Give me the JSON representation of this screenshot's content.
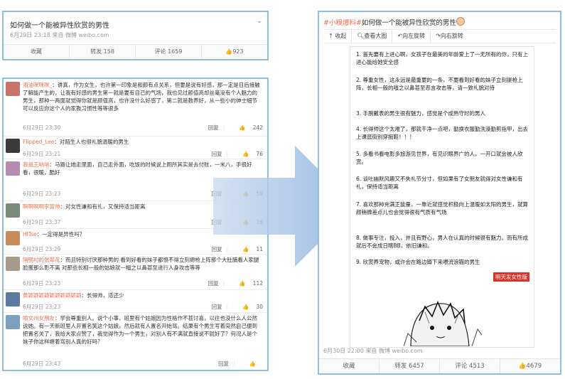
{
  "card1": {
    "title": "如何做一个能被异性欣赏的男性",
    "meta": "6月29日 23:18 来自 微博 weibo.com",
    "actions": [
      "收藏",
      "转发 158",
      "评论 1659",
      "923"
    ]
  },
  "comments": [
    {
      "user": "湘油咪咪咪_",
      "text": "：讲真，作为女生，也许第一印象是和颜有点关系，但要是说有好感，那一定是日后接触了解能产生的，让我有好感的男生第一就是要有自己的气场，我也见过颜值高却丝毫没有个人魅力的男生，那种一两面就觉得你就是颜值高，也许没什么好感了，第二就是教养好，从一些小的绅士细节可以反应你这个人的家教习惯性等等很多",
      "time": "6月29日 23:30",
      "reply": "回复",
      "likes": "242",
      "color": "#c9746a"
    },
    {
      "user": "Flipped_Lee",
      "text": "：对陌生人也很礼貌温暖的男生",
      "time": "6月29日 23:21",
      "reply": "回复",
      "likes": "76",
      "color": "#3a3a3a"
    },
    {
      "user": "我是王呐呐",
      "text": "：马路让她走里面，自己走外面，吃饭的时候说上厕所其实是去付账，一米八，手很好看，很暖，酷好",
      "time": "6月29日 23:23",
      "reply": "回复",
      "likes": "59",
      "color": "#b58bb0"
    },
    {
      "user": "啊啊啊啊李富帅",
      "text": "：对女性谦和有礼，又保持适当距离",
      "time": "6月29日 23:37",
      "reply": "回复",
      "likes": "16",
      "color": "#7a8a7a"
    },
    {
      "user": "HITse",
      "text": "：一定得是异性吗？",
      "time": "6月29日 23:29",
      "reply": "回复",
      "likes": "11",
      "color": "#c78a5a"
    },
    {
      "user": "隔壁村的张翠花",
      "text": "：而且特别讨厌那种男的 看到好看的妹子都恨不得立刻摁枪上阵那个大肚腩看人家腿脸蛋那么影不离 对那些长相一般的姑娘就一幅之以鼻甚至进行人身攻击等等",
      "time": "6月29日 23:23",
      "reply": "回复",
      "likes": "112",
      "color": "#a89a8a"
    },
    {
      "user": "黄颖颖颖颖颖颖颖颖颖颖",
      "text": "：长得帅，适还少",
      "time": "6月29日 23:23",
      "reply": "回复",
      "likes": "30",
      "color": "#5a7aa0"
    },
    {
      "user": "喻文州女朋友",
      "text": "：学会尊重别人。说个小事，班里有个姑娘因为性格作不甚讨喜，以往也没什么人公然说她。有一天新班里人开置名笑这个姑娘，然后就有人置名开始骂。结果有个男生写着突然自己便到把置名关了，我给大家点赞了，我觉得作为一个男生，对别人有不满就直接说不就好了？何况人是个妹子你这样缠着骂别人真的好吗？",
      "time": "6月29日 23:43",
      "reply": "回复",
      "likes": "",
      "color": "#7aa0c0"
    }
  ],
  "post": {
    "tag": "#小糗爆料#",
    "title": "如何做一个能被异性欣赏的男性",
    "toolbar": [
      "收起",
      "查看大图",
      "向左旋转",
      "向右旋转"
    ],
    "items": [
      "1. 首先要有上进心啊，女孩子在最美的年龄爱上了一无所有的你，只有上进心能给她安全感",
      "2. 尊重女性，这永远是最重要的一条，不要看到好看的妹子立刻提枪上阵，长相一般的嗤之以鼻甚至恶言攻击等，请一致礼貌对待",
      "3. 手腕戴表的男生很有魅力，感觉是个成熟守时的男人",
      "4. 长得帅这个太难了，那就干净一点吧，勤换衣服勤洗澡勤剪指甲，出去上课逛街别穿拖鞋！！！",
      "5. 多看书看电影多旅游见世界，有见识眼界广的人，一开口就会被人欣赏。",
      "6. 谈吐幽默风趣又不失礼节分寸，但如果有了女朋友就得对女性谦和有礼，保持适当距离",
      "7. 喜欢那种充满正能量，一靠近就感觉积极向上温暖如太阳的男生，就算颜稍微差点儿也会觉得很有气质有气场",
      "8. 做事专注，投入，并且有野心，男人在认真的时候很有魅力。而有所成就后不会成日瞎BB，依旧谦和。",
      "9. 欣赏养宠物，或许会在路边蹲下来喂流浪猫的男生"
    ],
    "brand": "明天发女性版",
    "meta": "6月30日 22:00 来自 微博 weibo.com",
    "actions": [
      "收藏",
      "转发 6457",
      "评论 4513",
      "4679"
    ]
  }
}
